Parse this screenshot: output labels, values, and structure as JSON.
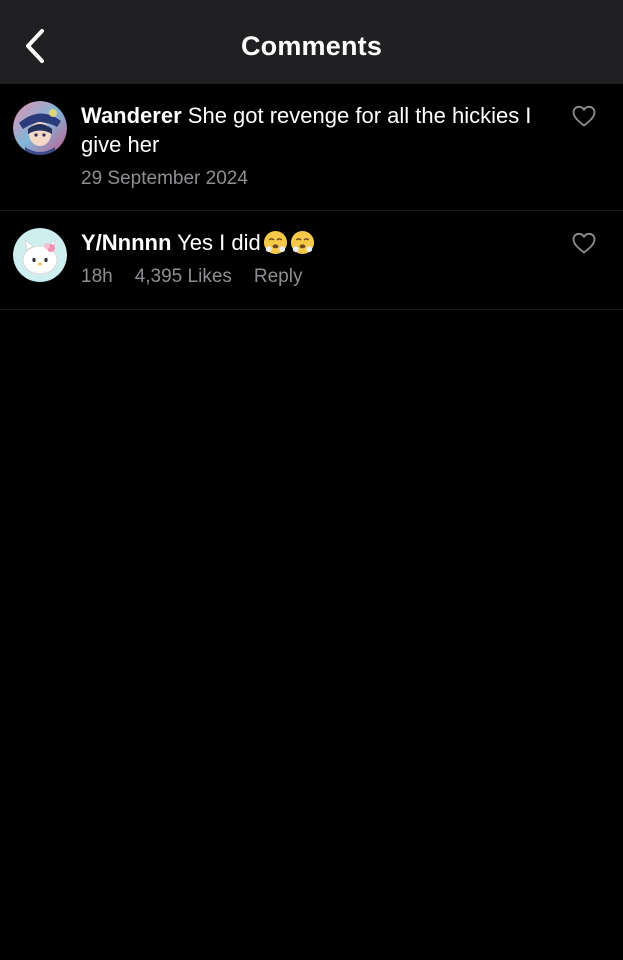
{
  "header": {
    "title": "Comments",
    "background": "#202022"
  },
  "icons": {
    "back": "chevron-left-icon",
    "like": "heart-outline-icon",
    "emoji": "face-with-steam-from-nose-emoji"
  },
  "comments": [
    {
      "username": "Wanderer",
      "text": "She got revenge for all the hickies I give her",
      "timestamp": "29 September 2024",
      "avatar": "anime-character-avatar"
    },
    {
      "username": "Y/Nnnnn",
      "text": "Yes I did",
      "emojis": [
        "😤",
        "😤"
      ],
      "timestamp": "18h",
      "likes": "4,395 Likes",
      "reply_label": "Reply",
      "avatar": "hello-kitty-avatar"
    }
  ],
  "colors": {
    "meta_text": "#8e8e93",
    "background": "#000000"
  }
}
